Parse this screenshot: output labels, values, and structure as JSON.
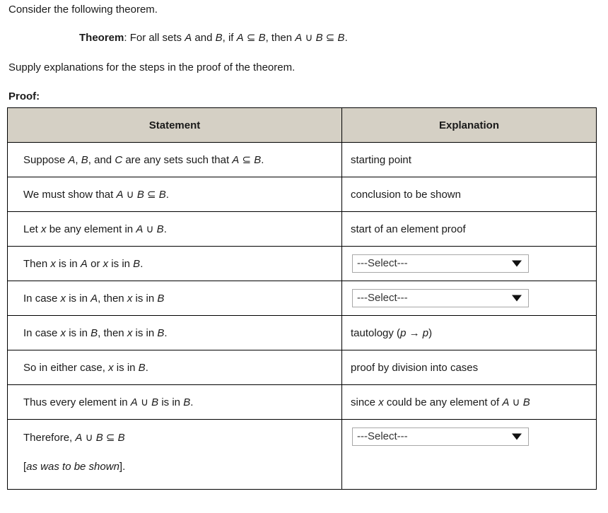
{
  "document": {
    "intro_1": "Consider the following theorem.",
    "theorem": {
      "label": "Theorem",
      "colon": ":",
      "body_1": " For all sets ",
      "var_A": "A",
      "body_2": " and ",
      "var_B": "B",
      "body_3": ", if ",
      "var_A2": "A",
      "subset_1": " ⊆ ",
      "var_B2": "B",
      "body_4": ", then ",
      "var_A3": "A",
      "union_1": " ∪ ",
      "var_B3": "B",
      "subset_2": " ⊆ ",
      "var_B4": "B",
      "period": "."
    },
    "intro_2": "Supply explanations for the steps in the proof of the theorem.",
    "proof_label": "Proof:"
  },
  "table": {
    "headers": {
      "statement": "Statement",
      "explanation": "Explanation"
    },
    "rows": [
      {
        "statement": "Suppose A, B, and C are any sets such that A ⊆ B.",
        "explanation_type": "text",
        "explanation": "starting point"
      },
      {
        "statement": "We must show that A ∪ B ⊆ B.",
        "explanation_type": "text",
        "explanation": "conclusion to be shown"
      },
      {
        "statement": "Let x be any element in A ∪ B.",
        "explanation_type": "text",
        "explanation": "start of an element proof"
      },
      {
        "statement": "Then x is in A or x is in B.",
        "explanation_type": "select",
        "explanation": "---Select---"
      },
      {
        "statement": "In case x is in A, then x is in B",
        "explanation_type": "select",
        "explanation": "---Select---"
      },
      {
        "statement": "In case x is in B, then x is in B.",
        "explanation_type": "text",
        "explanation": "tautology (p → p)"
      },
      {
        "statement": "So in either case, x is in B.",
        "explanation_type": "text",
        "explanation": "proof by division into cases"
      },
      {
        "statement": "Thus every element in A ∪ B is in B.",
        "explanation_type": "text",
        "explanation": "since x could be any element of A ∪ B"
      },
      {
        "statement_line_1": "Therefore, A ∪ B ⊆ B",
        "statement_line_2": "[as was to be shown].",
        "explanation_type": "select",
        "explanation": "---Select---"
      }
    ]
  },
  "select_widget": {
    "placeholder": "---Select---",
    "arrow_icon": "chevron-down-icon"
  },
  "colors": {
    "header_background": "#d5d0c5",
    "border": "#000000",
    "text": "#1a1a1a",
    "select_border": "#a8a8a8"
  }
}
